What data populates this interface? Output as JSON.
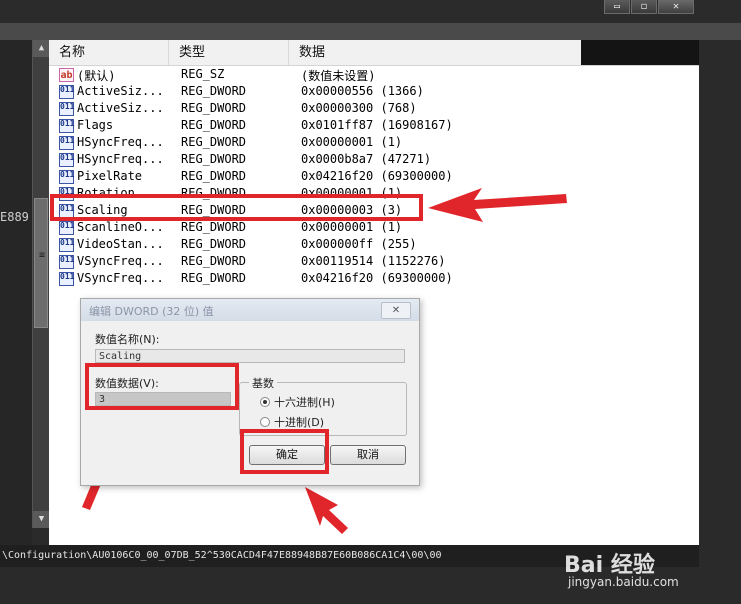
{
  "window": {
    "minimize": "▭",
    "maximize": "◻",
    "close": "✕"
  },
  "left_pane": {
    "fragment": "E889"
  },
  "list": {
    "columns": [
      "名称",
      "类型",
      "数据"
    ],
    "rows": [
      {
        "icon": "ab",
        "name": "(默认)",
        "type": "REG_SZ",
        "data": "(数值未设置)"
      },
      {
        "icon": "011",
        "name": "ActiveSiz...",
        "type": "REG_DWORD",
        "data": "0x00000556 (1366)"
      },
      {
        "icon": "011",
        "name": "ActiveSiz...",
        "type": "REG_DWORD",
        "data": "0x00000300 (768)"
      },
      {
        "icon": "011",
        "name": "Flags",
        "type": "REG_DWORD",
        "data": "0x0101ff87 (16908167)"
      },
      {
        "icon": "011",
        "name": "HSyncFreq...",
        "type": "REG_DWORD",
        "data": "0x00000001 (1)"
      },
      {
        "icon": "011",
        "name": "HSyncFreq...",
        "type": "REG_DWORD",
        "data": "0x0000b8a7 (47271)"
      },
      {
        "icon": "011",
        "name": "PixelRate",
        "type": "REG_DWORD",
        "data": "0x04216f20 (69300000)"
      },
      {
        "icon": "011",
        "name": "Rotation",
        "type": "REG_DWORD",
        "data": "0x00000001 (1)"
      },
      {
        "icon": "011",
        "name": "Scaling",
        "type": "REG_DWORD",
        "data": "0x00000003 (3)"
      },
      {
        "icon": "011",
        "name": "ScanlineO...",
        "type": "REG_DWORD",
        "data": "0x00000001 (1)"
      },
      {
        "icon": "011",
        "name": "VideoStan...",
        "type": "REG_DWORD",
        "data": "0x000000ff (255)"
      },
      {
        "icon": "011",
        "name": "VSyncFreq...",
        "type": "REG_DWORD",
        "data": "0x00119514 (1152276)"
      },
      {
        "icon": "011",
        "name": "VSyncFreq...",
        "type": "REG_DWORD",
        "data": "0x04216f20 (69300000)"
      }
    ]
  },
  "dialog": {
    "title": "编辑 DWORD (32 位) 值",
    "close": "✕",
    "name_label": "数值名称(N):",
    "name_value": "Scaling",
    "data_label": "数值数据(V):",
    "data_value": "3",
    "base_label": "基数",
    "hex_label": "十六进制(H)",
    "dec_label": "十进制(D)",
    "base_selected": "十六进制(H)",
    "ok": "确定",
    "cancel": "取消"
  },
  "status_path": "\\Configuration\\AU0106C0_00_07DB_52^530CACD4F47E88948B87E60B086CA1C4\\00\\00",
  "watermark": {
    "logo": "Bai 经验",
    "url": "jingyan.baidu.com"
  },
  "colors": {
    "highlight": "#e0262b",
    "dark_bg": "#2a2a2a"
  }
}
